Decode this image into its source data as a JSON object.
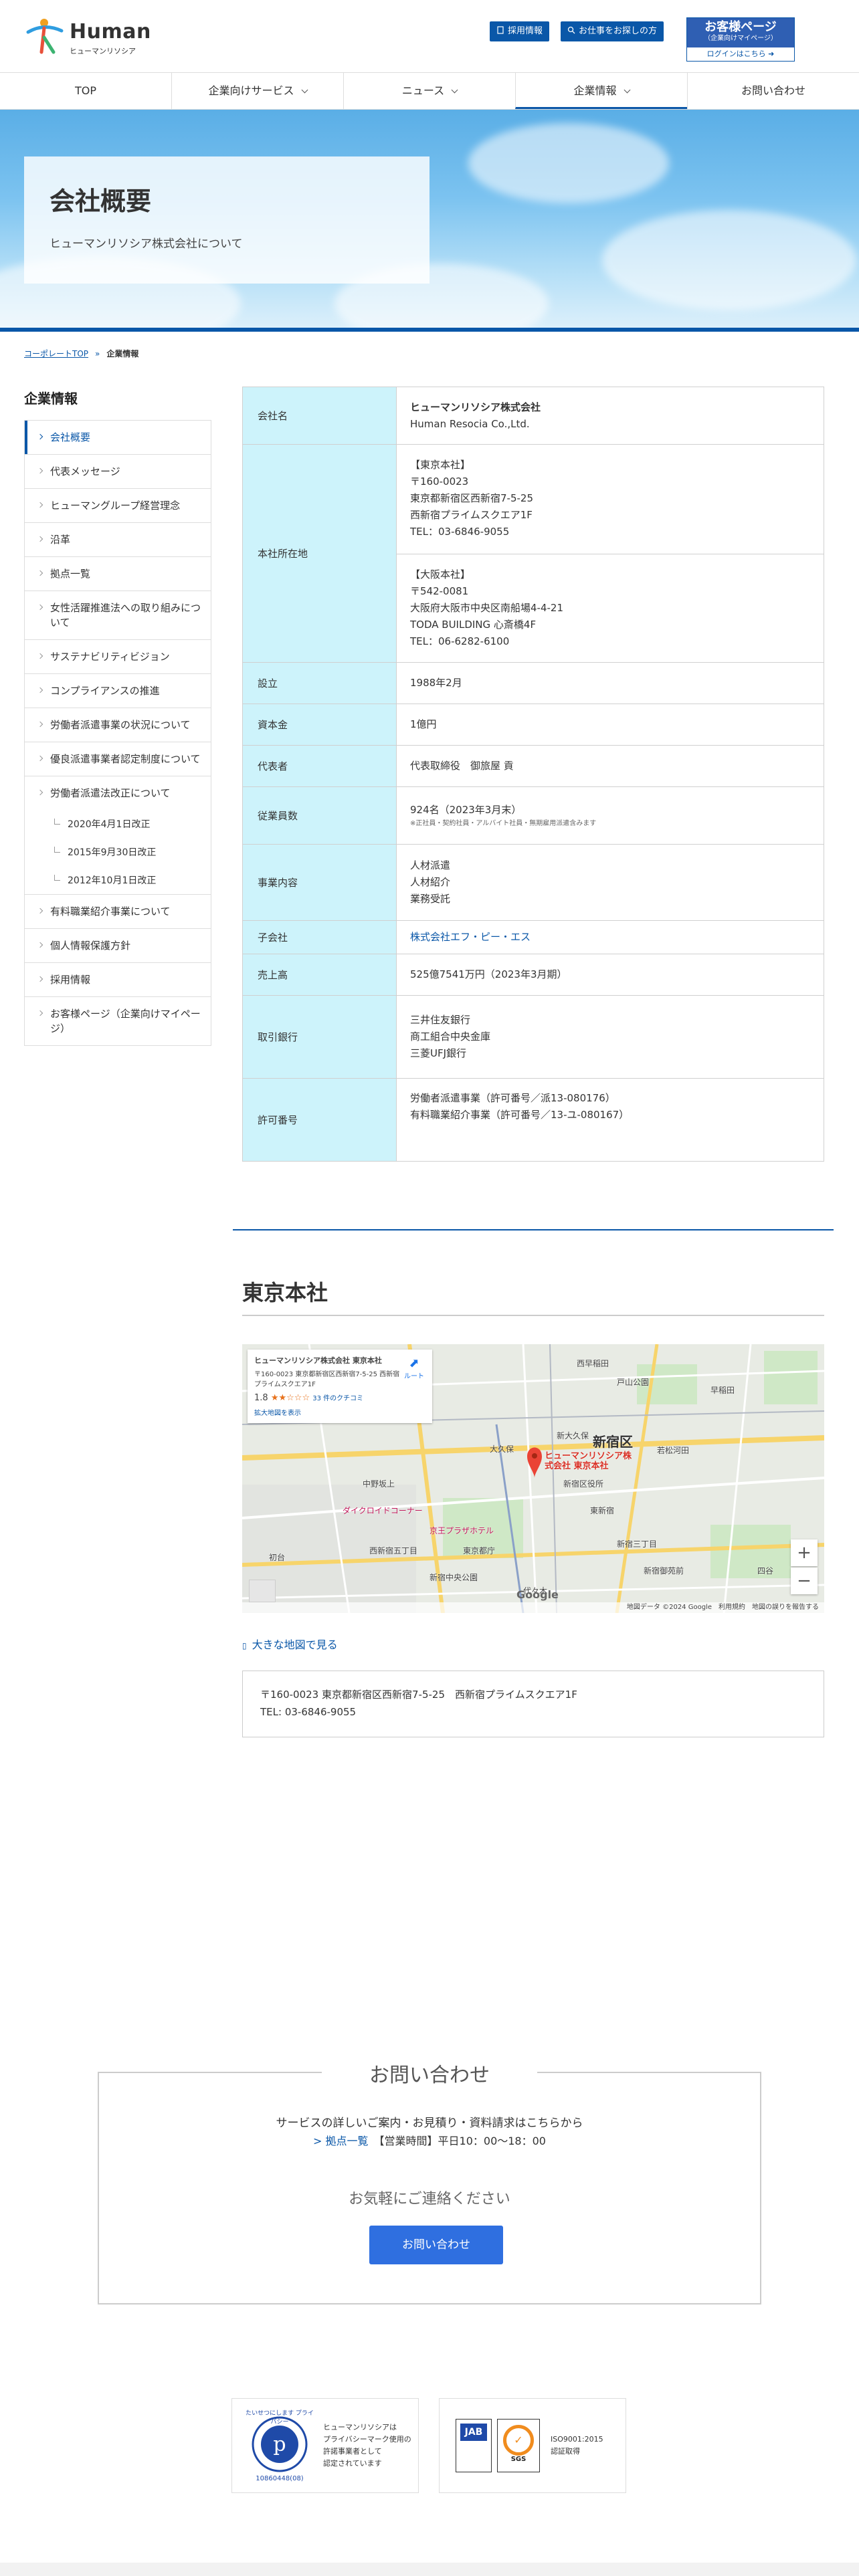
{
  "brand": {
    "name_en": "Human",
    "name_jp": "ヒューマンリソシア"
  },
  "header": {
    "recruit": "採用情報",
    "job_search": "お仕事をお探しの方",
    "customer_title": "お客様ページ",
    "customer_sub": "（企業向けマイページ）",
    "login": "ログインはこちら"
  },
  "nav": {
    "items": [
      "TOP",
      "企業向けサービス",
      "ニュース",
      "企業情報",
      "お問い合わせ"
    ]
  },
  "hero": {
    "title": "会社概要",
    "subtitle": "ヒューマンリソシア株式会社について"
  },
  "breadcrumb": {
    "home": "コーポレートTOP",
    "sep": "»",
    "current": "企業情報"
  },
  "sidebar": {
    "title": "企業情報",
    "items": [
      "会社概要",
      "代表メッセージ",
      "ヒューマングループ経営理念",
      "沿革",
      "拠点一覧",
      "女性活躍推進法への取り組みについて",
      "サステナビリティビジョン",
      "コンプライアンスの推進",
      "労働者派遣事業の状況について",
      "優良派遣事業者認定制度について",
      "労働者派遣法改正について",
      "有料職業紹介事業について",
      "個人情報保護方針",
      "採用情報",
      "お客様ページ（企業向けマイページ）"
    ],
    "subitems": [
      "2020年4月1日改正",
      "2015年9月30日改正",
      "2012年10月1日改正"
    ]
  },
  "company": {
    "name_label": "会社名",
    "name_jp": "ヒューマンリソシア株式会社",
    "name_en": "Human Resocia Co.,Ltd.",
    "address_label": "本社所在地",
    "tokyo": [
      "【東京本社】",
      "〒160-0023",
      "東京都新宿区西新宿7-5-25",
      "西新宿プライムスクエア1F",
      "TEL：03-6846-9055"
    ],
    "osaka": [
      "【大阪本社】",
      "〒542-0081",
      "大阪府大阪市中央区南船場4-4-21",
      "TODA BUILDING 心斎橋4F",
      "TEL：06-6282-6100"
    ],
    "founded_label": "設立",
    "founded": "1988年2月",
    "capital_label": "資本金",
    "capital": "1億円",
    "rep_label": "代表者",
    "rep": "代表取締役　御旅屋 貢",
    "employees_label": "従業員数",
    "employees": "924名（2023年3月末）",
    "employees_note": "※正社員・契約社員・アルバイト社員・無期雇用派遣含みます",
    "business_label": "事業内容",
    "business": [
      "人材派遣",
      "人材紹介",
      "業務受託"
    ],
    "subsidiary_label": "子会社",
    "subsidiary": "株式会社エフ・ピー・エス",
    "sales_label": "売上高",
    "sales": "525億7541万円（2023年3月期）",
    "banks_label": "取引銀行",
    "banks": [
      "三井住友銀行",
      "商工組合中央金庫",
      "三菱UFJ銀行"
    ],
    "license_label": "許可番号",
    "licenses": [
      "労働者派遣事業（許可番号／派13-080176）",
      "有料職業紹介事業（許可番号／13-ユ-080167）"
    ]
  },
  "hq": {
    "title": "東京本社",
    "map_card_title": "ヒューマンリソシア株式会社 東京本社",
    "map_card_addr": "〒160-0023 東京都新宿区西新宿7-5-25 西新宿プライムスクエア1F",
    "rating": "1.8",
    "stars": "★★☆☆☆",
    "reviews": "33 件のクチコミ",
    "map_card_link": "拡大地図を表示",
    "route": "ルート",
    "pin_label": "ヒューマンリソシア株式会社 東京本社",
    "district": "新宿区",
    "labels": [
      "大久保",
      "新大久保",
      "戸山公園",
      "中野坂上",
      "西新宿五丁目",
      "新宿中央公園",
      "東京都庁",
      "新宿御苑前",
      "若松河田",
      "早稲田",
      "西早稲田",
      "東新宿",
      "新宿三丁目",
      "代々木",
      "初台",
      "ダイクロイドコーナー",
      "京王プラザホテル",
      "新宿区役所",
      "四谷"
    ],
    "zoom_in": "+",
    "zoom_out": "−",
    "google": "Google",
    "map_footer": "地図データ ©2024 Google　利用規約　地図の誤りを報告する",
    "larger_map": "大きな地図で見る",
    "addr_line1": "〒160-0023 東京都新宿区西新宿7-5-25　西新宿プライムスクエア1F",
    "addr_line2": "TEL: 03-6846-9055"
  },
  "contact": {
    "title": "お問い合わせ",
    "line1": "サービスの詳しいご案内・お見積り・資料請求はこちらから",
    "branches_link": "> 拠点一覧",
    "hours": "【営業時間】平日10：00〜18：00",
    "line3": "お気軽にご連絡ください",
    "button": "お問い合わせ"
  },
  "certs": {
    "privacy_text": [
      "ヒューマンリソシアは",
      "プライバシーマーク使用の",
      "許諾事業者として",
      "認定されています"
    ],
    "privacy_num": "10860448(08)",
    "privacy_mark_caption": "たいせつにします プライバシー",
    "iso_text": [
      "ISO9001:2015",
      "認証取得"
    ],
    "jab": "JAB",
    "sgs": "SGS"
  },
  "colors": {
    "brand_blue": "#0a57a8",
    "table_header": "#cdf3fb",
    "button_blue": "#2f6fe0"
  }
}
